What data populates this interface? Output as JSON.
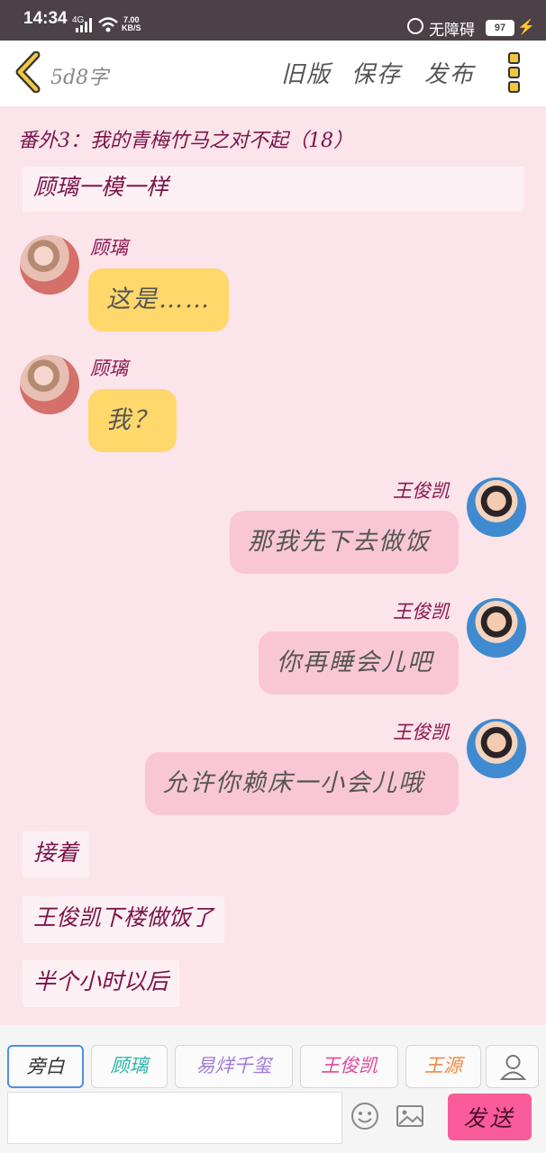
{
  "status": {
    "time": "14:34",
    "network": "4G",
    "speed_value": "7.00",
    "speed_unit": "KB/S",
    "accessibility": "无障碍",
    "battery": "97"
  },
  "header": {
    "word_count": "5d8字",
    "old_version": "旧版",
    "save": "保存",
    "publish": "发布"
  },
  "chapter_title": "番外3：我的青梅竹马之对不起（18）",
  "story": [
    {
      "type": "narration",
      "text": "顾璃一模一样"
    },
    {
      "type": "message",
      "side": "left",
      "sender": "顾璃",
      "text": "这是……"
    },
    {
      "type": "message",
      "side": "left",
      "sender": "顾璃",
      "text": "我？"
    },
    {
      "type": "message",
      "side": "right",
      "sender": "王俊凯",
      "text": "那我先下去做饭"
    },
    {
      "type": "message",
      "side": "right",
      "sender": "王俊凯",
      "text": "你再睡会儿吧"
    },
    {
      "type": "message",
      "side": "right",
      "sender": "王俊凯",
      "text": "允许你赖床一小会儿哦"
    },
    {
      "type": "narration",
      "text": "接着"
    },
    {
      "type": "narration",
      "text": "王俊凯下楼做饭了"
    },
    {
      "type": "narration",
      "text": "半个小时以后"
    }
  ],
  "roles": [
    {
      "label": "旁白",
      "color": "#555555"
    },
    {
      "label": "顾璃",
      "color": "#2fb3a6"
    },
    {
      "label": "易烊千玺",
      "color": "#a07ad8"
    },
    {
      "label": "王俊凯",
      "color": "#e2489a"
    },
    {
      "label": "王源",
      "color": "#f08a46"
    }
  ],
  "composer": {
    "input_value": "",
    "send": "发送"
  },
  "colors": {
    "accent": "#f95c99",
    "bubble_left": "#ffd76b",
    "bubble_right": "#f9c7d4",
    "narration_text": "#7a1448"
  },
  "icons": [
    "back-chevron-icon",
    "more-menu-icon",
    "emoji-icon",
    "image-icon",
    "user-icon"
  ]
}
